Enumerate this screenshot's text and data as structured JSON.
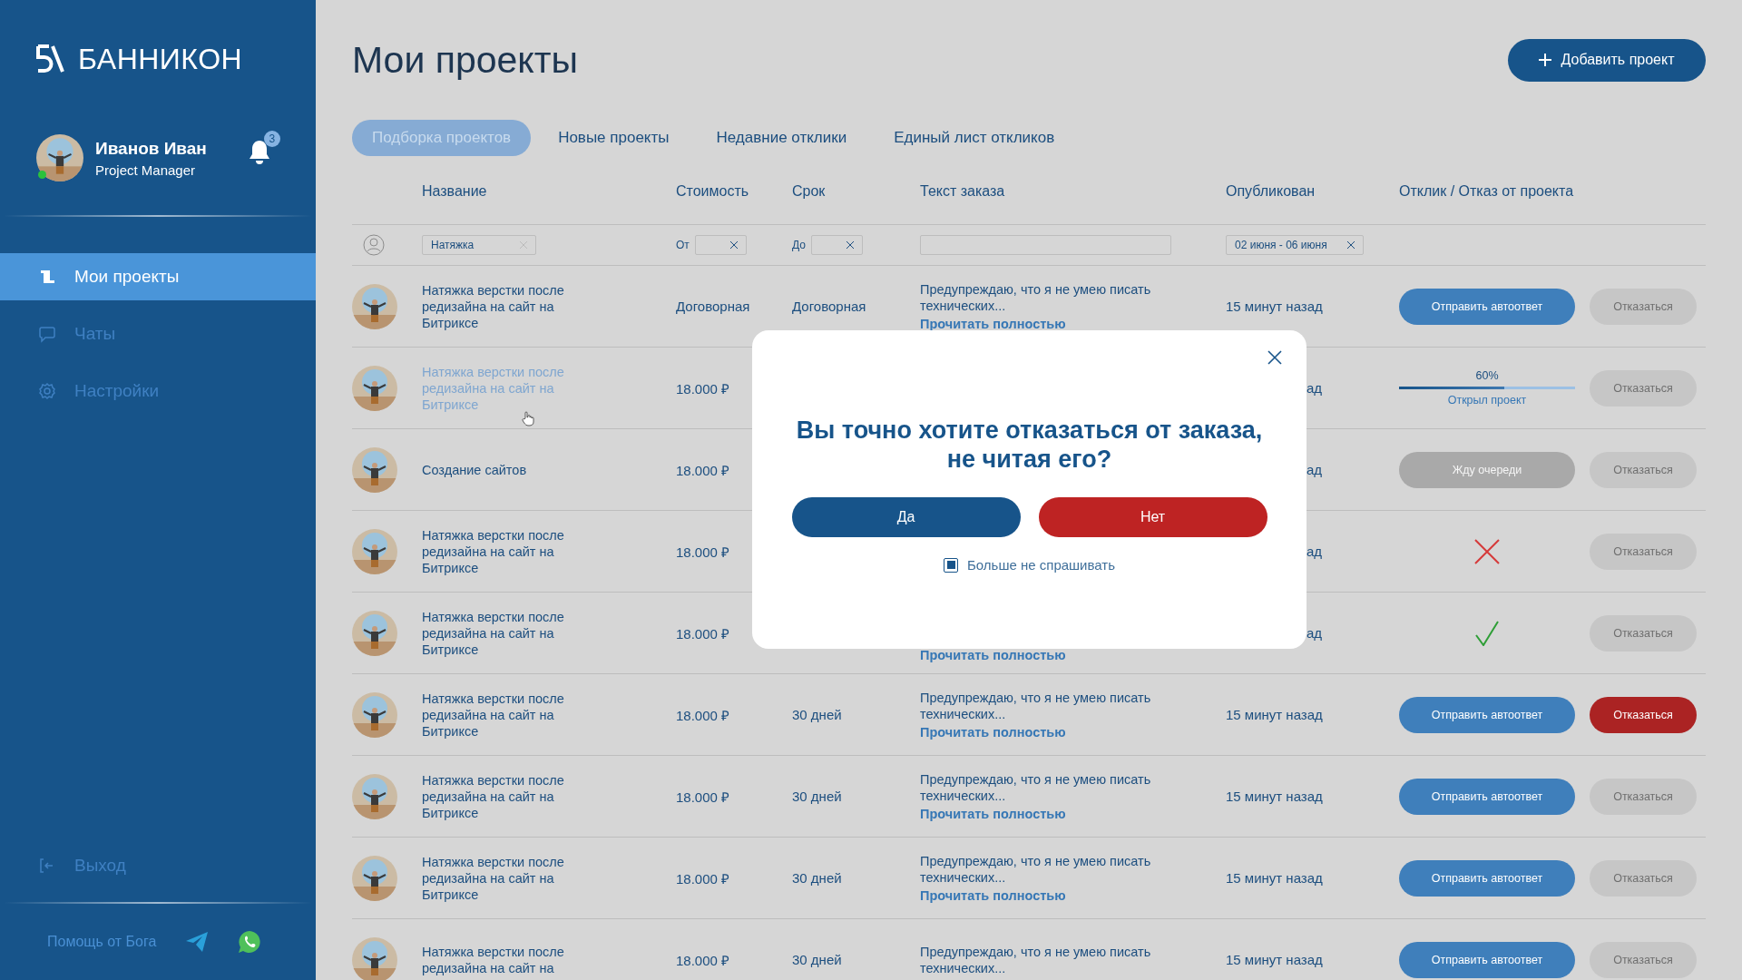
{
  "sidebar": {
    "brand": "БАННИКОН",
    "user": {
      "name": "Иванов Иван",
      "role": "Project Manager",
      "online": true,
      "notifications": "3"
    },
    "menu": [
      {
        "label": "Мои проекты",
        "selected": true
      },
      {
        "label": "Чаты",
        "selected": false
      },
      {
        "label": "Настройки",
        "selected": false
      }
    ],
    "logout": "Выход",
    "help": "Помощь от Бога"
  },
  "page": {
    "title": "Мои проекты",
    "add_button": "Добавить проект"
  },
  "tabs": [
    {
      "label": "Подборка проектов",
      "selected": true
    },
    {
      "label": "Новые проекты",
      "selected": false
    },
    {
      "label": "Недавние отклики",
      "selected": false
    },
    {
      "label": "Единый лист откликов",
      "selected": false
    }
  ],
  "table": {
    "columns": [
      "Название",
      "Стоимость",
      "Срок",
      "Текст заказа",
      "Опубликован",
      "Отклик / Отказ от проекта"
    ],
    "filters": {
      "name": "Натяжка",
      "cost_from_label": "От",
      "cost_to_label": "До",
      "published": "02 июня - 06 июня"
    },
    "rows": [
      {
        "name": "Натяжка верстки после редизайна на сайт на Битриксе",
        "hovered": false,
        "covered": false,
        "price": "Договорная",
        "term": "Договорная",
        "text": "Предупреждаю, что я не умею писать технических...",
        "link": "Прочитать полностью",
        "published": "15 минут назад",
        "response": {
          "kind": "autoreply",
          "label": "Отправить автоответ"
        },
        "refuse": {
          "label": "Отказаться",
          "active": false
        }
      },
      {
        "name": "Натяжка верстки после редизайна на сайт на Битриксе",
        "hovered": true,
        "covered": true,
        "price": "18.000 ₽",
        "published": "ад",
        "response": {
          "kind": "progress",
          "level": 0.6,
          "reading": "60%",
          "caption": "Открыл проект"
        },
        "refuse": {
          "label": "Отказаться",
          "active": false
        }
      },
      {
        "name": "Создание сайтов",
        "hovered": false,
        "covered": true,
        "price": "18.000 ₽",
        "published": "ад",
        "response": {
          "kind": "waiting",
          "label": "Жду очереди"
        },
        "refuse": {
          "label": "Отказаться",
          "active": false
        }
      },
      {
        "name": "Натяжка верстки после редизайна на сайт на Битриксе",
        "hovered": false,
        "covered": true,
        "price": "18.000 ₽",
        "published": "ад",
        "response": {
          "kind": "rejected"
        },
        "refuse": {
          "label": "Отказаться",
          "active": false
        }
      },
      {
        "name": "Натяжка верстки после редизайна на сайт на Битриксе",
        "hovered": false,
        "covered": true,
        "price": "18.000 ₽",
        "link": "Прочитать полностью",
        "published": "ад",
        "response": {
          "kind": "accepted"
        },
        "refuse": {
          "label": "Отказаться",
          "active": false
        }
      },
      {
        "name": "Натяжка верстки после редизайна на сайт на Битриксе",
        "hovered": false,
        "covered": false,
        "price": "18.000 ₽",
        "term": "30 дней",
        "text": "Предупреждаю, что я не умею писать технических...",
        "link": "Прочитать полностью",
        "published": "15 минут назад",
        "response": {
          "kind": "autoreply",
          "label": "Отправить автоответ"
        },
        "refuse": {
          "label": "Отказаться",
          "active": true
        }
      },
      {
        "name": "Натяжка верстки после редизайна на сайт на Битриксе",
        "hovered": false,
        "covered": false,
        "price": "18.000 ₽",
        "term": "30 дней",
        "text": "Предупреждаю, что я не умею писать технических...",
        "link": "Прочитать полностью",
        "published": "15 минут назад",
        "response": {
          "kind": "autoreply",
          "label": "Отправить автоответ"
        },
        "refuse": {
          "label": "Отказаться",
          "active": false
        }
      },
      {
        "name": "Натяжка верстки после редизайна на сайт на Битриксе",
        "hovered": false,
        "covered": false,
        "price": "18.000 ₽",
        "term": "30 дней",
        "text": "Предупреждаю, что я не умею писать технических...",
        "link": "Прочитать полностью",
        "published": "15 минут назад",
        "response": {
          "kind": "autoreply",
          "label": "Отправить автоответ"
        },
        "refuse": {
          "label": "Отказаться",
          "active": false
        }
      },
      {
        "name": "Натяжка верстки после редизайна на сайт на",
        "hovered": false,
        "covered": false,
        "price": "18.000 ₽",
        "term": "30 дней",
        "text": "Предупреждаю, что я не умею писать технических...",
        "published": "15 минут назад",
        "response": {
          "kind": "autoreply",
          "label": "Отправить автоответ"
        },
        "refuse": {
          "label": "Отказаться",
          "active": false
        }
      }
    ]
  },
  "dialog": {
    "title": "Вы точно хотите отказаться от заказа, не читая его?",
    "buttons": [
      {
        "label": "Да",
        "kind": "confirm"
      },
      {
        "label": "Нет",
        "kind": "cancel"
      }
    ],
    "checkbox": {
      "label": "Больше не спрашивать",
      "checked": true
    }
  }
}
